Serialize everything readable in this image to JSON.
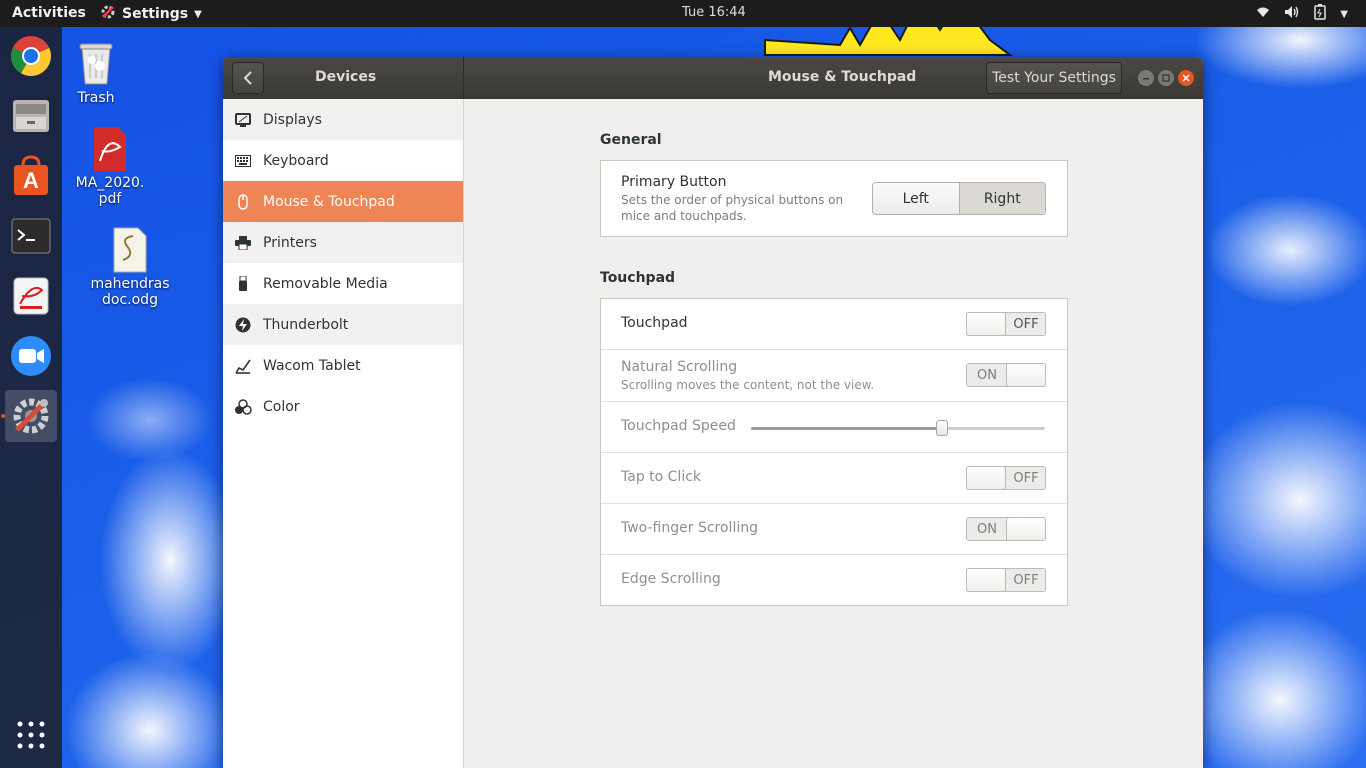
{
  "topbar": {
    "activities": "Activities",
    "app_menu": "Settings",
    "clock": "Tue 16:44"
  },
  "desktop_icons": [
    {
      "label": "Trash"
    },
    {
      "label": "MA_2020.\npdf"
    },
    {
      "label": "mahendras\ndoc.odg"
    }
  ],
  "window": {
    "panel_title": "Devices",
    "title": "Mouse & Touchpad",
    "test_button": "Test Your Settings"
  },
  "sidebar": {
    "items": [
      {
        "label": "Displays",
        "icon": "display-icon"
      },
      {
        "label": "Keyboard",
        "icon": "keyboard-icon"
      },
      {
        "label": "Mouse & Touchpad",
        "icon": "mouse-icon",
        "selected": true
      },
      {
        "label": "Printers",
        "icon": "printer-icon"
      },
      {
        "label": "Removable Media",
        "icon": "usb-icon"
      },
      {
        "label": "Thunderbolt",
        "icon": "thunderbolt-icon"
      },
      {
        "label": "Wacom Tablet",
        "icon": "tablet-icon"
      },
      {
        "label": "Color",
        "icon": "color-icon"
      }
    ]
  },
  "general": {
    "heading": "General",
    "primary_button": {
      "label": "Primary Button",
      "description": "Sets the order of physical buttons on mice and touchpads.",
      "options": [
        "Left",
        "Right"
      ],
      "selected": "Right"
    }
  },
  "touchpad": {
    "heading": "Touchpad",
    "touchpad": {
      "label": "Touchpad",
      "state": "OFF"
    },
    "natural_scrolling": {
      "label": "Natural Scrolling",
      "description": "Scrolling moves the content, not the view.",
      "state": "ON"
    },
    "speed": {
      "label": "Touchpad Speed",
      "value_fraction": 0.65
    },
    "tap_to_click": {
      "label": "Tap to Click",
      "state": "OFF"
    },
    "two_finger": {
      "label": "Two-finger Scrolling",
      "state": "ON"
    },
    "edge": {
      "label": "Edge Scrolling",
      "state": "OFF"
    }
  },
  "colors": {
    "accent": "#ef8555",
    "headerbar": "#3f3e39",
    "close": "#e95420"
  }
}
